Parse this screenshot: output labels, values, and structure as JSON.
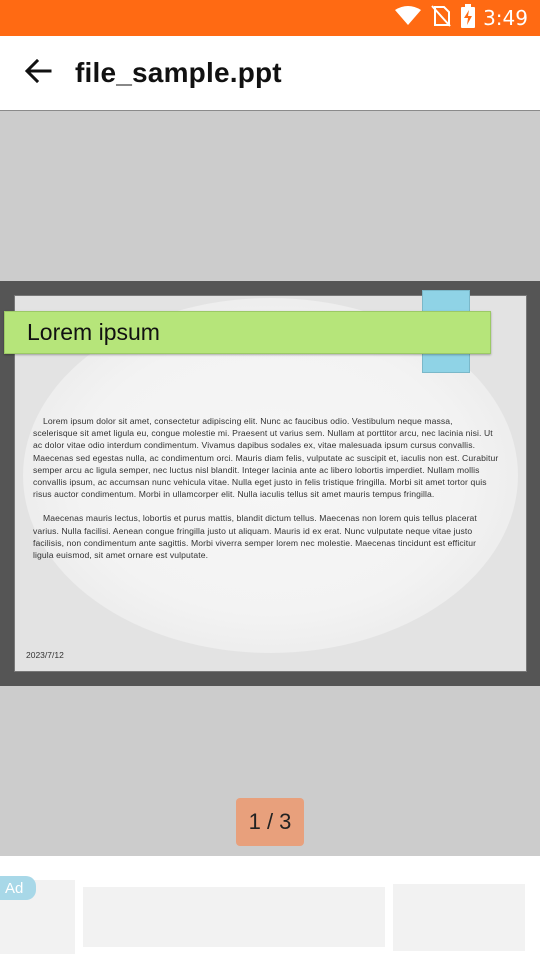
{
  "status_bar": {
    "time": "3:49",
    "icons": [
      "wifi-icon",
      "no-sim-icon",
      "battery-charging-icon"
    ]
  },
  "app_bar": {
    "back_icon": "arrow-left-icon",
    "title": "file_sample.ppt"
  },
  "slide": {
    "title": "Lorem ipsum",
    "paragraphs": [
      "Lorem ipsum dolor sit amet, consectetur adipiscing elit. Nunc ac faucibus odio. Vestibulum neque massa, scelerisque sit amet ligula eu, congue molestie mi. Praesent ut varius sem. Nullam at porttitor arcu, nec lacinia nisi. Ut ac dolor vitae odio interdum condimentum. Vivamus dapibus sodales ex, vitae malesuada ipsum cursus convallis. Maecenas sed egestas nulla, ac condimentum orci. Mauris diam felis, vulputate ac suscipit et, iaculis non est. Curabitur semper arcu ac ligula semper, nec luctus nisl blandit. Integer lacinia ante ac libero lobortis imperdiet. Nullam mollis convallis ipsum, ac accumsan nunc vehicula vitae. Nulla eget justo in felis tristique fringilla. Morbi sit amet tortor quis risus auctor condimentum. Morbi in ullamcorper elit. Nulla iaculis tellus sit amet mauris tempus fringilla.",
      "Maecenas mauris lectus, lobortis et purus mattis, blandit dictum tellus. Maecenas non lorem quis tellus placerat varius. Nulla facilisi. Aenean congue fringilla justo ut aliquam. Mauris id ex erat. Nunc vulputate neque vitae justo facilisis, non condimentum ante sagittis. Morbi viverra semper lorem nec molestie. Maecenas tincidunt est efficitur ligula euismod, sit amet ornare est vulputate."
    ],
    "date": "2023/7/12"
  },
  "pager": {
    "label": "1 / 3"
  },
  "ad": {
    "label": "Ad"
  },
  "colors": {
    "status_bar": "#ff6a13",
    "banner_green": "#b6e57a",
    "tab_blue": "#8fd3e6",
    "pager_badge": "#e8a07c"
  }
}
